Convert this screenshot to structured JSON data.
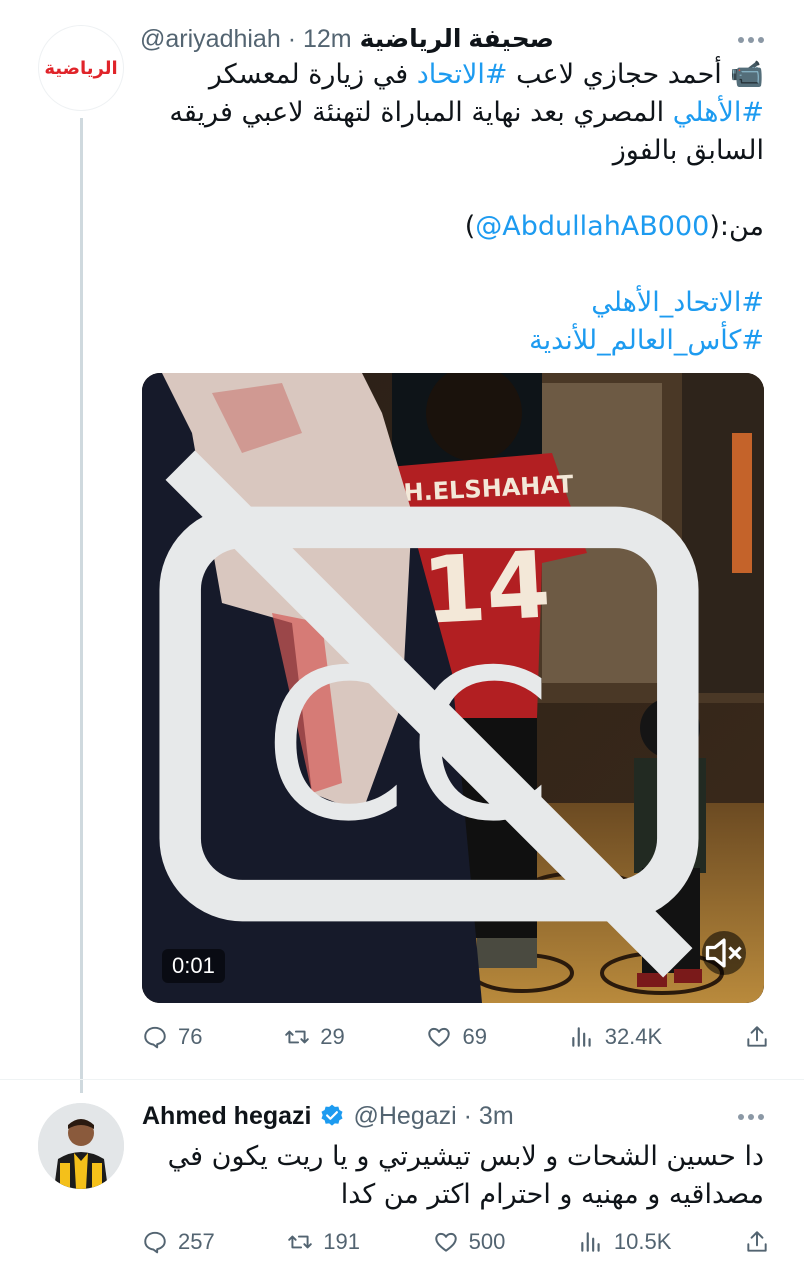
{
  "tweet1": {
    "name": "صحيفة الرياضية",
    "handle": "@ariyadhiah",
    "time": "· 12m",
    "avatar_logo": "الرياضية",
    "line1_pre": "أحمد حجازي لاعب",
    "line1_tag": "#الاتحاد",
    "line1_post": "في زيارة لمعسكر",
    "line2_tag": "#الأهلي",
    "line2_post": "المصري بعد نهاية المباراة لتهنئة لاعبي فريقه",
    "line3": "السابق بالفوز",
    "from_label": "من:(",
    "from_mention": "@AbdullahAB000",
    "from_close": ")",
    "hashtag1": "#الاتحاد_الأهلي",
    "hashtag2": "#كأس_العالم_للأندية",
    "video_time": "0:01",
    "jersey_name": "H.ELSHAHAT",
    "jersey_number": "14",
    "stats": {
      "replies": "76",
      "retweets": "29",
      "likes": "69",
      "views": "32.4K"
    }
  },
  "tweet2": {
    "name": "Ahmed hegazi",
    "handle": "@Hegazi",
    "time": "· 3m",
    "line1": "دا حسين الشحات و لابس تيشيرتي و يا ريت يكون في",
    "line2": "مصداقيه و مهنيه و احترام اكتر من كدا",
    "stats": {
      "replies": "257",
      "retweets": "191",
      "likes": "500",
      "views": "10.5K"
    }
  },
  "colors": {
    "link": "#1d9bf0",
    "muted": "#536471",
    "verified": "#1d9bf0",
    "thread_line": "#cfd9de"
  },
  "icons": [
    "video-camera-emoji-icon",
    "verified-badge-icon",
    "more-icon",
    "reply-icon",
    "retweet-icon",
    "like-icon",
    "views-icon",
    "share-icon",
    "mute-icon",
    "captions-icon"
  ]
}
